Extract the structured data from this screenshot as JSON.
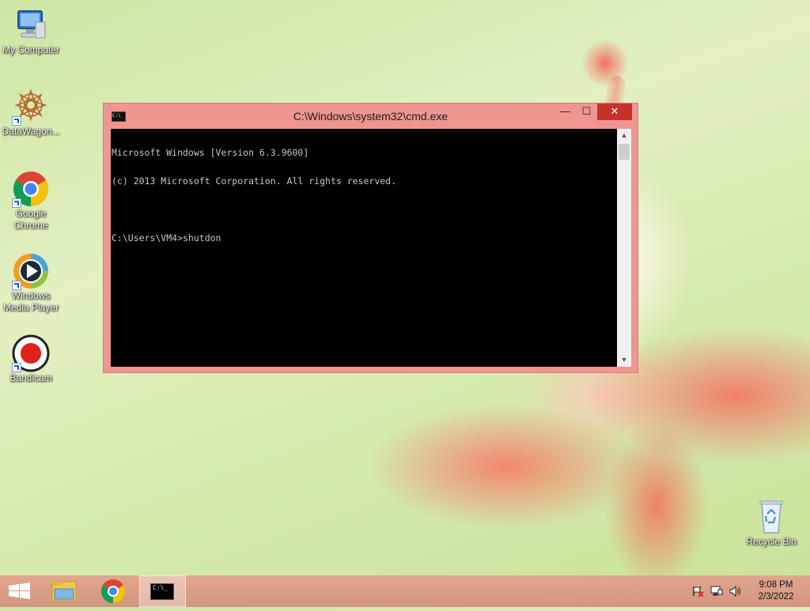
{
  "desktop": {
    "icons": [
      {
        "label": "My Computer"
      },
      {
        "label": "DataWagon..."
      },
      {
        "label": "Google Chrome"
      },
      {
        "label": "Windows Media Player"
      },
      {
        "label": "Bandicam"
      },
      {
        "label": "Recycle Bin"
      }
    ]
  },
  "window": {
    "icon_text": "C:\\",
    "title": "C:\\Windows\\system32\\cmd.exe",
    "buttons": {
      "minimize": "—",
      "maximize": "☐",
      "close": "✕"
    },
    "console_lines": [
      "Microsoft Windows [Version 6.3.9600]",
      "(c) 2013 Microsoft Corporation. All rights reserved.",
      "",
      "C:\\Users\\VM4>shutdon"
    ]
  },
  "taskbar": {
    "items": [
      "start-button",
      "file-explorer",
      "google-chrome",
      "command-prompt"
    ],
    "cmd_icon_text": "C:\\_"
  },
  "tray": {
    "icons": [
      "action-center-flag-icon",
      "network-icon",
      "volume-icon"
    ],
    "time": "9:08 PM",
    "date": "2/3/2022"
  }
}
